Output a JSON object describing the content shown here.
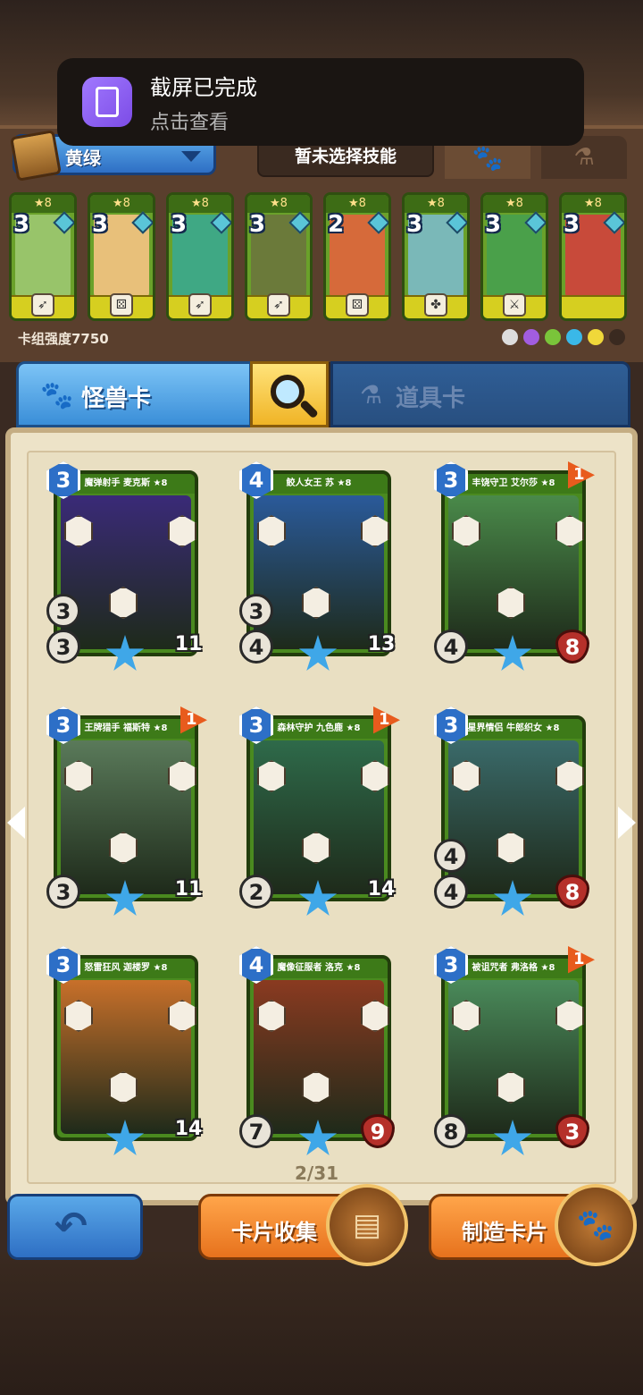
{
  "toast": {
    "title": "截屏已完成",
    "subtitle": "点击查看"
  },
  "deck": {
    "name": "黄绿",
    "skill_label": "暂未选择技能",
    "strength_label": "卡组强度7750",
    "mini_cards": [
      {
        "star": "★8",
        "cost": "3",
        "color": "#98c46a",
        "icon": "bow-icon",
        "icon_char": "➶"
      },
      {
        "star": "★8",
        "cost": "3",
        "color": "#e8c07a",
        "icon": "dice-icon",
        "icon_char": "⚄"
      },
      {
        "star": "★8",
        "cost": "3",
        "color": "#3fa884",
        "icon": "bow-icon",
        "icon_char": "➶"
      },
      {
        "star": "★8",
        "cost": "3",
        "color": "#6b7a3a",
        "icon": "bow-icon",
        "icon_char": "➶"
      },
      {
        "star": "★8",
        "cost": "2",
        "color": "#d66a3a",
        "icon": "dice-icon",
        "icon_char": "⚄"
      },
      {
        "star": "★8",
        "cost": "3",
        "color": "#7ab8b8",
        "icon": "clover-icon",
        "icon_char": "✤"
      },
      {
        "star": "★8",
        "cost": "3",
        "color": "#4aa04a",
        "icon": "sword-icon",
        "icon_char": "⚔"
      },
      {
        "star": "★8",
        "cost": "3",
        "color": "#c84a3a",
        "icon": "none",
        "icon_char": ""
      }
    ]
  },
  "tabs": {
    "monster": "怪兽卡",
    "items": "道具卡"
  },
  "cards": [
    {
      "title": "魔弹射手 麦克斯 ★8",
      "cost": "3",
      "flag": "",
      "lv": "3",
      "atk": "3",
      "hp": "11",
      "art": "#3a2a78"
    },
    {
      "title": "鲛人女王 苏 ★8",
      "cost": "4",
      "flag": "",
      "lv": "3",
      "atk": "4",
      "hp": "13",
      "art": "#2a5a9a"
    },
    {
      "title": "丰饶守卫 艾尔莎 ★8",
      "cost": "3",
      "flag": "1",
      "lv": "",
      "atk": "4",
      "hp": "8",
      "art": "#4a8a4a"
    },
    {
      "title": "王牌猎手 福斯特 ★8",
      "cost": "3",
      "flag": "1",
      "lv": "",
      "atk": "3",
      "hp": "11",
      "art": "#5a7a5a"
    },
    {
      "title": "森林守护 九色鹿 ★8",
      "cost": "3",
      "flag": "1",
      "lv": "",
      "atk": "2",
      "hp": "14",
      "art": "#2e6a4a"
    },
    {
      "title": "星界情侣 牛郎织女 ★8",
      "cost": "3",
      "flag": "",
      "lv": "4",
      "atk": "4",
      "hp": "8",
      "art": "#3a6a6a"
    },
    {
      "title": "怒雷狂风 迦楼罗 ★8",
      "cost": "3",
      "flag": "",
      "lv": "",
      "atk": "",
      "hp": "14",
      "art": "#c8702a"
    },
    {
      "title": "魔像征服者 洛克 ★8",
      "cost": "4",
      "flag": "",
      "lv": "",
      "atk": "7",
      "hp": "9",
      "art": "#8a3a20"
    },
    {
      "title": "被诅咒者 弗洛格 ★8",
      "cost": "3",
      "flag": "1",
      "lv": "",
      "atk": "8",
      "hp": "3",
      "art": "#4a8a5a"
    }
  ],
  "page": "2/31",
  "buttons": {
    "collect": "卡片收集",
    "craft": "制造卡片"
  }
}
